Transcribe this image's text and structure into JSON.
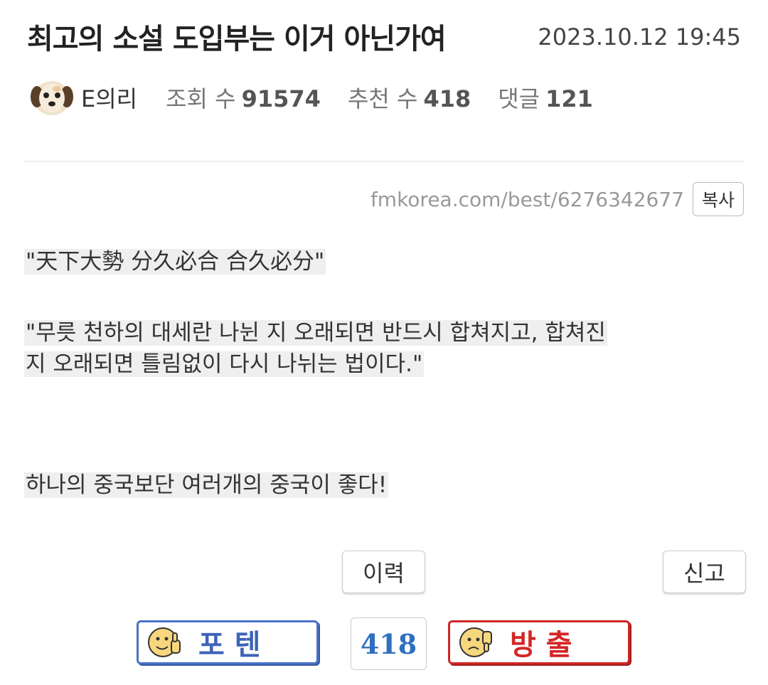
{
  "post": {
    "title": "최고의 소설 도입부는 이거 아닌가여",
    "date": "2023.10.12 19:45",
    "author": "E의리",
    "views_label": "조회 수",
    "views": "91574",
    "recommend_label": "추천 수",
    "recommend": "418",
    "comments_label": "댓글",
    "comments": "121",
    "url": "fmkorea.com/best/6276342677",
    "copy_label": "복사",
    "body": {
      "p1": "\"天下大勢 分久必合 合久必分\"",
      "p2_line1": "\"무릇 천하의 대세란 나뉜 지 오래되면 반드시 합쳐지고, 합쳐진",
      "p2_line2": "지 오래되면 틀림없이 다시 나뉘는 법이다.\"",
      "p3": "하나의 중국보단 여러개의 중국이 좋다!"
    }
  },
  "actions": {
    "history_label": "이력",
    "report_label": "신고",
    "upvote_label": "포텐",
    "vote_count": "418",
    "downvote_label": "방출"
  },
  "colors": {
    "upvote": "#3e63b8",
    "downvote": "#d42626",
    "vote_count": "#2e6fc0",
    "highlight": "#efefef"
  },
  "icons": {
    "avatar": "puppy-avatar",
    "upvote": "thumbs-up-face-icon",
    "downvote": "thumbs-down-face-icon"
  }
}
